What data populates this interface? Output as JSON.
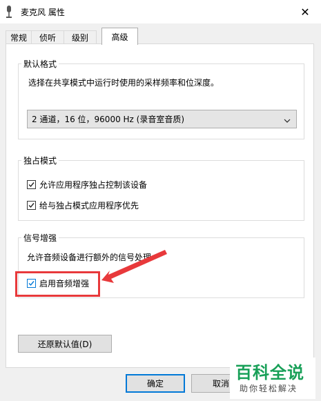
{
  "window": {
    "title": "麦克风 属性",
    "close_glyph": "✕"
  },
  "tabs": [
    {
      "label": "常规"
    },
    {
      "label": "侦听"
    },
    {
      "label": "级别"
    },
    {
      "label": "高级"
    }
  ],
  "default_format": {
    "group_label": "默认格式",
    "description": "选择在共享模式中运行时使用的采样频率和位深度。",
    "selected_value": "2 通道，16 位，96000 Hz (录音室音质)"
  },
  "exclusive_mode": {
    "group_label": "独占模式",
    "options": [
      {
        "label": "允许应用程序独占控制该设备",
        "checked": true
      },
      {
        "label": "给与独占模式应用程序优先",
        "checked": true
      }
    ]
  },
  "signal_enhancement": {
    "group_label": "信号增强",
    "description": "允许音频设备进行额外的信号处理",
    "option": {
      "label": "启用音频增强",
      "checked": true
    }
  },
  "buttons": {
    "restore_defaults": "还原默认值(D)",
    "ok": "确定",
    "cancel": "取消"
  },
  "watermark": {
    "title": "百科全说",
    "subtitle": "助你轻松解决"
  },
  "colors": {
    "highlight": "#e8393b",
    "watermark_green": "#18a058",
    "focus_blue": "#0078d7"
  }
}
